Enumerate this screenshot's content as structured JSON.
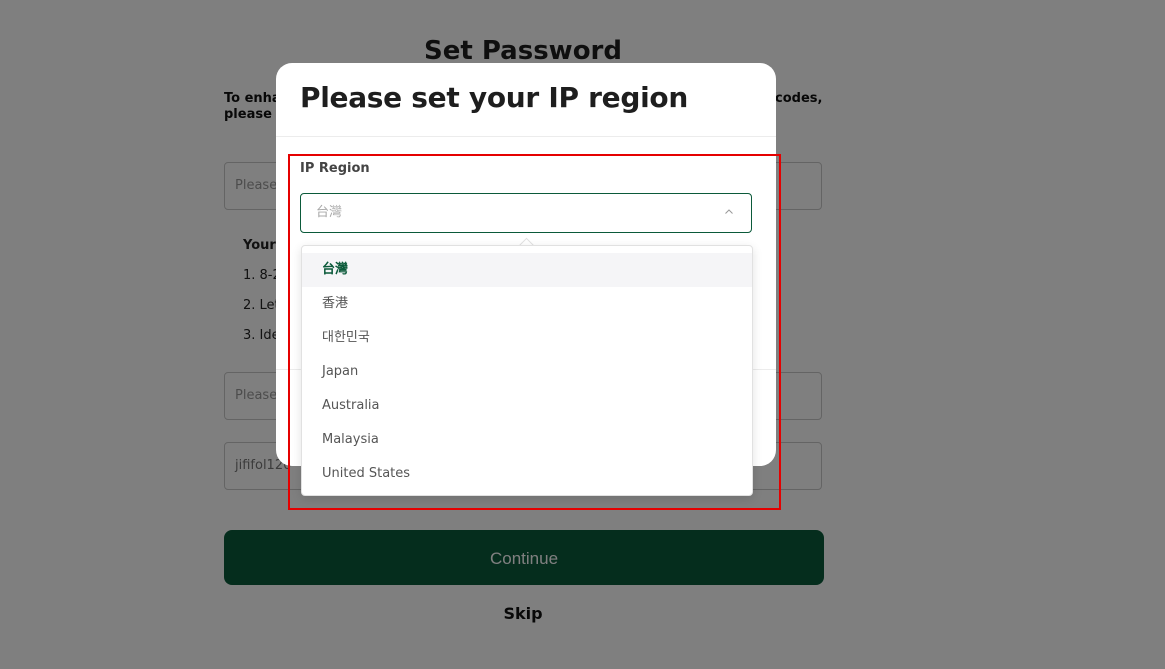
{
  "background": {
    "title": "Set Password",
    "intro_line1_start": "To enhar",
    "intro_line1_end": "codes,",
    "intro_line2_start": "please s",
    "password_placeholder": "Please",
    "rules_heading": "Your",
    "rules": [
      "1. 8-2",
      "2. Let",
      "3. Ide"
    ],
    "confirm_placeholder": "Please",
    "email_value": "jififol120",
    "continue_label": "Continue",
    "skip_label": "Skip"
  },
  "modal": {
    "title": "Please set your IP region",
    "field_label": "IP Region",
    "selected_value": "台灣"
  },
  "dropdown": {
    "options": [
      "台灣",
      "香港",
      "대한민국",
      "Japan",
      "Australia",
      "Malaysia",
      "United States"
    ],
    "selected_index": 0
  },
  "colors": {
    "accent": "#0b5a3a",
    "highlight": "#e50000"
  }
}
